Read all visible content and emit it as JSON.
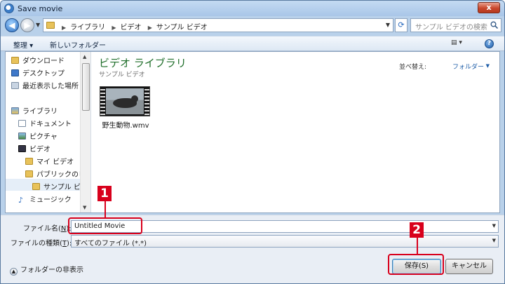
{
  "window": {
    "title": "Save movie",
    "close_label": "x"
  },
  "address": {
    "crumbs": [
      "ライブラリ",
      "ビデオ",
      "サンプル ビデオ"
    ],
    "search_placeholder": "サンプル ビデオの検索"
  },
  "toolbar": {
    "organize": "整理 ▾",
    "new_folder": "新しいフォルダー"
  },
  "sidebar": {
    "items": [
      {
        "label": "ダウンロード",
        "icon": "download-folder-icon"
      },
      {
        "label": "デスクトップ",
        "icon": "desktop-icon"
      },
      {
        "label": "最近表示した場所",
        "icon": "recent-places-icon"
      },
      {
        "label": "ライブラリ",
        "icon": "library-icon"
      },
      {
        "label": "ドキュメント",
        "icon": "documents-icon"
      },
      {
        "label": "ピクチャ",
        "icon": "pictures-icon"
      },
      {
        "label": "ビデオ",
        "icon": "videos-icon"
      },
      {
        "label": "マイ ビデオ",
        "icon": "folder-icon"
      },
      {
        "label": "パブリックのビデオ",
        "icon": "folder-icon"
      },
      {
        "label": "サンプル ビデオ",
        "icon": "folder-icon"
      },
      {
        "label": "ミュージック",
        "icon": "music-icon"
      }
    ]
  },
  "main": {
    "library_title": "ビデオ ライブラリ",
    "library_subtitle": "サンプル ビデオ",
    "arrange_label": "並べ替え:",
    "arrange_value": "フォルダー",
    "files": [
      {
        "name": "野生動物.wmv"
      }
    ]
  },
  "form": {
    "filename_label_prefix": "ファイル名(",
    "filename_label_key": "N",
    "filename_label_suffix": "):",
    "filename_value": "Untitled Movie",
    "filetype_label_prefix": "ファイルの種類(",
    "filetype_label_key": "T",
    "filetype_label_suffix": "):",
    "filetype_value": "すべてのファイル (*.*)",
    "hide_folders": "フォルダーの非表示",
    "save_button": "保存(S)",
    "cancel_button": "キャンセル"
  },
  "callouts": [
    "1",
    "2"
  ],
  "colors": {
    "accent_red": "#d8001c",
    "library_green": "#1f6e2a",
    "link_blue": "#1f5ea8"
  }
}
